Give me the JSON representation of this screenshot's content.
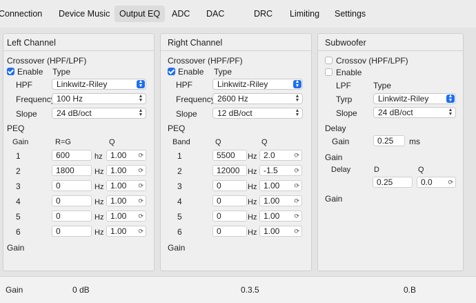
{
  "tabs": [
    "Connection",
    "Device Music",
    "Output EQ",
    "ADC",
    "DAC",
    "DRC",
    "Limiting",
    "Settings"
  ],
  "colors": {
    "accent": "#1e6ff1"
  },
  "left": {
    "title": "Left Channel",
    "crossover": "Crossover  (HPF/LPF)",
    "enable": "Enable",
    "type": "Type",
    "hpf": "HPF",
    "hpf_value": "Linkwitz-Riley",
    "frequency": "Frequency",
    "freq_value": "100 Hz",
    "slope": "Slope",
    "slope_value": "24 dB/oct",
    "peq": "PEQ",
    "col_gain": "Gain",
    "col_freq": "R=G",
    "col_q": "Q",
    "rows": [
      {
        "n": "1",
        "f": "600",
        "u": "hz",
        "q": "1.00"
      },
      {
        "n": "2",
        "f": "1800",
        "u": "Hz",
        "q": "1.00"
      },
      {
        "n": "3",
        "f": "0",
        "u": "Hz",
        "q": "1.00"
      },
      {
        "n": "4",
        "f": "0",
        "u": "Hz",
        "q": "1.00"
      },
      {
        "n": "5",
        "f": "0",
        "u": "Hz",
        "q": "1.00"
      },
      {
        "n": "6",
        "f": "0",
        "u": "Hz",
        "q": "1.00"
      }
    ],
    "gain": "Gain"
  },
  "right": {
    "title": "Right Channel",
    "crossover": "Crossover  (HPF/PF)",
    "enable": "Enable",
    "type": "Type",
    "hpf": "HPF",
    "hpf_value": "Linkwitz-Riley",
    "frequency": "Frequency",
    "freq_value": "2600 Hz",
    "slope": "Slope",
    "slope_value": "12 dB/oct",
    "peq": "PEQ",
    "col_gain": "Band",
    "col_freq": "Q",
    "col_q": "Q",
    "rows": [
      {
        "n": "1",
        "f": "5500",
        "u": "Hz",
        "q": "2.0"
      },
      {
        "n": "2",
        "f": "12000",
        "u": "Hz",
        "q": "-1.5"
      },
      {
        "n": "3",
        "f": "0",
        "u": "Hz",
        "q": "1.00"
      },
      {
        "n": "4",
        "f": "0",
        "u": "Hz",
        "q": "1.00"
      },
      {
        "n": "5",
        "f": "0",
        "u": "Hz",
        "q": "1.00"
      },
      {
        "n": "6",
        "f": "0",
        "u": "Hz",
        "q": "1.00"
      }
    ],
    "gain": "Gain"
  },
  "sub": {
    "title": "Subwoofer",
    "crossover": "Crossov  (HPF/LPF)",
    "enable": "Enable",
    "lpf": "LPF",
    "type": "Type",
    "type_label": "Tyrp",
    "type_value": "Linkwitz-Riley",
    "slope": "Slope",
    "slope_value": "24 dB/oct",
    "delay": "Delay",
    "gain_label": "Gain",
    "gain_value": "0.25",
    "ms": "ms",
    "gain_head": "Gain",
    "delay2": "Delay",
    "col_d": "D",
    "col_q": "Q",
    "d_value": "0.25",
    "q_value": "0.0",
    "gain_bottom": "Gain"
  },
  "status": {
    "label": "Gain",
    "gain": "0 dB",
    "mid": "0.3.5",
    "right": "0.B"
  }
}
